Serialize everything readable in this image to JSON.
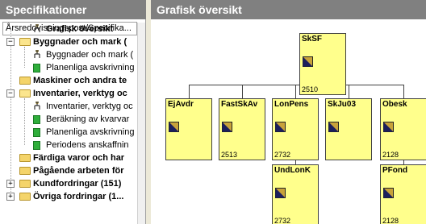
{
  "left_panel": {
    "title": "Specifikationer",
    "column_header": "Årsredovisningspost/Specifika...",
    "tree": [
      {
        "label": "Grafisk översikt",
        "bold": true,
        "icon": "org-chart-icon",
        "expander": ""
      },
      {
        "label": "Byggnader och mark (",
        "bold": true,
        "icon": "folder-open-icon",
        "expander": "−"
      },
      {
        "label": "Byggnader och mark (",
        "bold": false,
        "icon": "org-chart-icon",
        "expander": ""
      },
      {
        "label": "Planenliga avskrivning",
        "bold": false,
        "icon": "green-doc-icon",
        "expander": ""
      },
      {
        "label": "Maskiner och andra te",
        "bold": true,
        "icon": "folder-icon",
        "expander": ""
      },
      {
        "label": "Inventarier, verktyg oc",
        "bold": true,
        "icon": "folder-open-icon",
        "expander": "−"
      },
      {
        "label": "Inventarier, verktyg oc",
        "bold": false,
        "icon": "org-chart-icon",
        "expander": ""
      },
      {
        "label": "Beräkning av kvarvar",
        "bold": false,
        "icon": "green-doc-icon",
        "expander": ""
      },
      {
        "label": "Planenliga avskrivning",
        "bold": false,
        "icon": "green-doc-icon",
        "expander": ""
      },
      {
        "label": "Periodens anskaffnin",
        "bold": false,
        "icon": "green-doc-icon",
        "expander": ""
      },
      {
        "label": "Färdiga varor och har",
        "bold": true,
        "icon": "folder-icon",
        "expander": ""
      },
      {
        "label": "Pågående arbeten för",
        "bold": true,
        "icon": "folder-icon",
        "expander": ""
      },
      {
        "label": "Kundfordringar (151)",
        "bold": true,
        "icon": "folder-icon",
        "expander": "+"
      },
      {
        "label": "Övriga fordringar (1...",
        "bold": true,
        "icon": "folder-icon",
        "expander": "+"
      }
    ]
  },
  "right_panel": {
    "title": "Grafisk översikt",
    "nodes": [
      {
        "code": "SkSF",
        "number": "2510"
      },
      {
        "code": "EjAvdr",
        "number": ""
      },
      {
        "code": "FastSkAv",
        "number": "2513"
      },
      {
        "code": "LonPens",
        "number": "2732"
      },
      {
        "code": "SkJu03",
        "number": ""
      },
      {
        "code": "Obesk",
        "number": "2128"
      },
      {
        "code": "UndLonK",
        "number": "2732"
      },
      {
        "code": "PFond",
        "number": "2128"
      }
    ]
  },
  "colors": {
    "header_bg": "#808080",
    "node_bg": "#ffff8c",
    "folder": "#f4d46a",
    "doc_green": "#2fae3b"
  }
}
